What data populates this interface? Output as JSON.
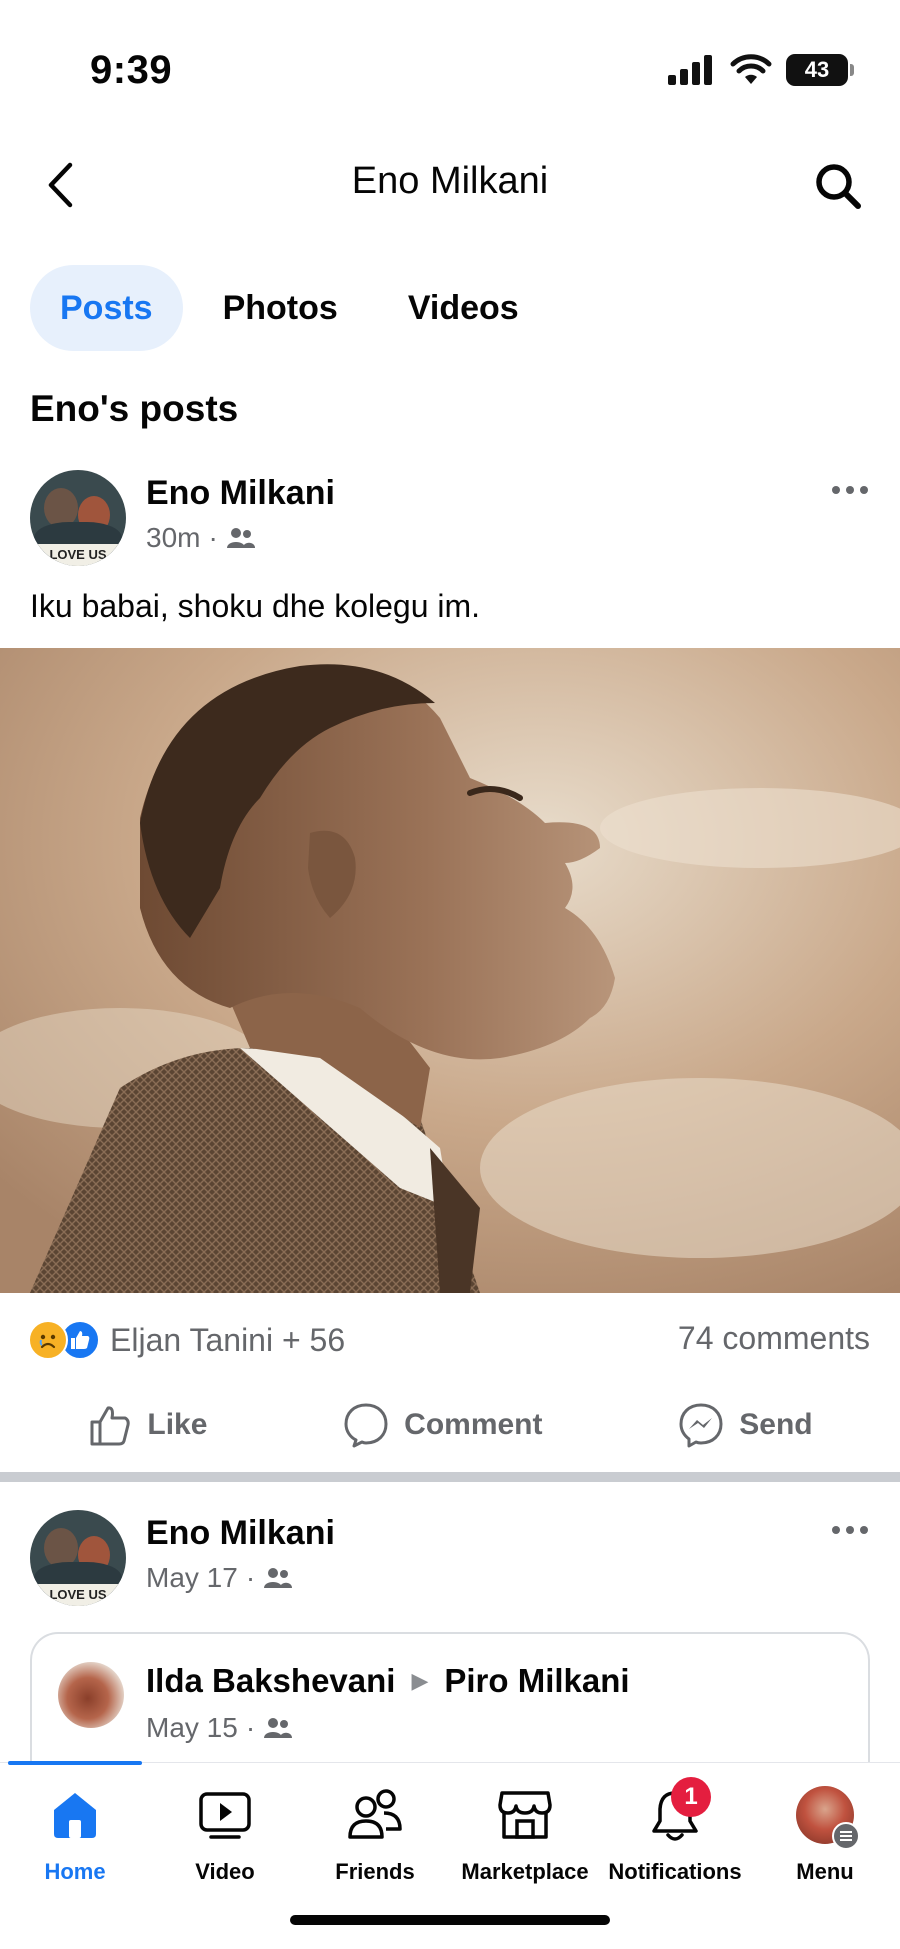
{
  "status_bar": {
    "time": "9:39",
    "battery": "43"
  },
  "nav": {
    "title": "Eno Milkani"
  },
  "tabs": [
    {
      "label": "Posts",
      "active": true
    },
    {
      "label": "Photos",
      "active": false
    },
    {
      "label": "Videos",
      "active": false
    }
  ],
  "section_title": "Eno's posts",
  "posts": [
    {
      "author": "Eno Milkani",
      "time": "30m",
      "avatar_caption": "LOVE US",
      "text": "Iku babai, shoku dhe kolegu im.",
      "reactions": "Eljan Tanini + 56",
      "comments": "74 comments"
    },
    {
      "author": "Eno Milkani",
      "time": "May 17",
      "avatar_caption": "LOVE US",
      "shared": {
        "from": "Ilda Bakshevani",
        "to": "Piro Milkani",
        "time": "May 15"
      }
    }
  ],
  "actions": {
    "like": "Like",
    "comment": "Comment",
    "send": "Send"
  },
  "tab_bar": [
    {
      "label": "Home",
      "icon": "home-icon",
      "active": true
    },
    {
      "label": "Video",
      "icon": "video-icon",
      "active": false
    },
    {
      "label": "Friends",
      "icon": "friends-icon",
      "active": false
    },
    {
      "label": "Marketplace",
      "icon": "marketplace-icon",
      "active": false
    },
    {
      "label": "Notifications",
      "icon": "bell-icon",
      "active": false,
      "badge": "1"
    },
    {
      "label": "Menu",
      "icon": "profile-avatar",
      "active": false
    }
  ],
  "colors": {
    "accent": "#1877f2",
    "badge": "#e41e3f",
    "secondary_text": "#65676b"
  }
}
